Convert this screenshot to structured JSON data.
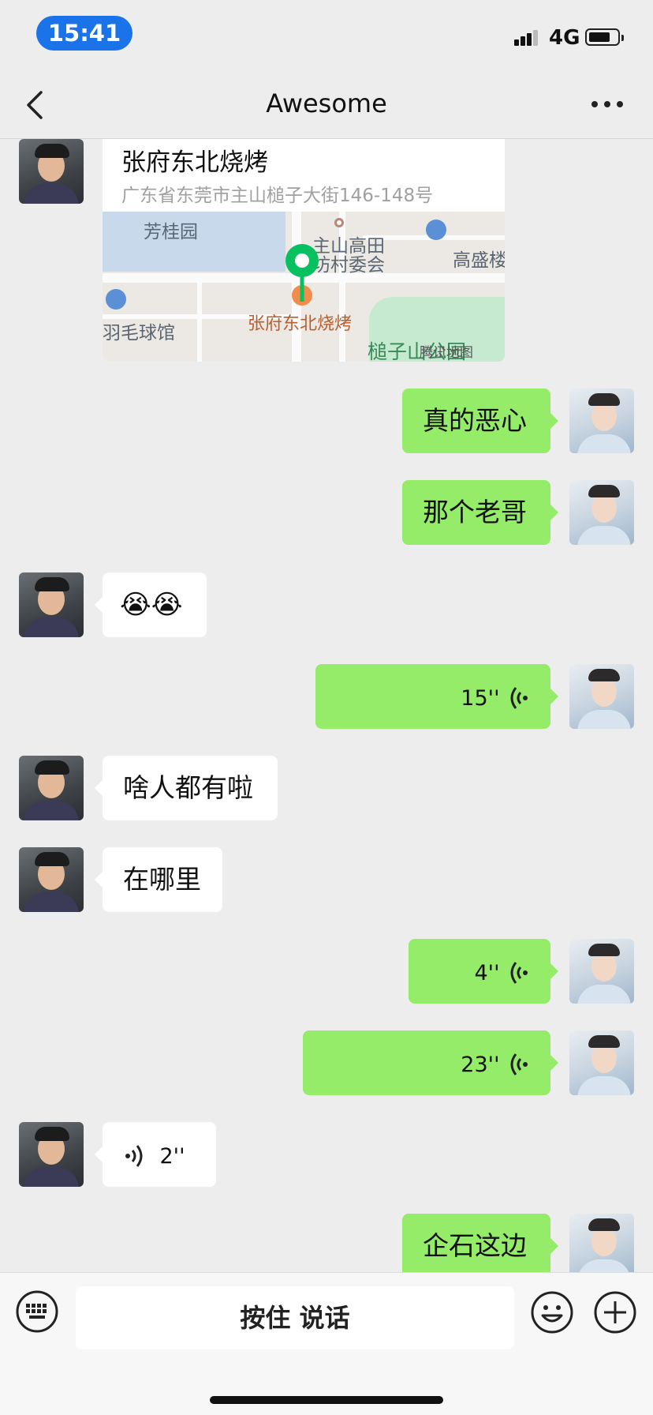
{
  "status_bar": {
    "time": "15:41",
    "network": "4G"
  },
  "nav": {
    "title": "Awesome"
  },
  "location": {
    "name": "张府东北烧烤",
    "address": "广东省东莞市主山槌子大街146-148号",
    "map_labels": {
      "area": "芳桂园",
      "committee_line1": "主山高田",
      "committee_line2": "坊村委会",
      "building": "高盛楼",
      "gym": "羽毛球馆",
      "poi": "张府东北烧烤",
      "park": "槌子山公园",
      "provider": "腾讯地图"
    }
  },
  "messages": [
    {
      "side": "right",
      "type": "text",
      "text": "真的恶心"
    },
    {
      "side": "right",
      "type": "text",
      "text": "那个老哥"
    },
    {
      "side": "left",
      "type": "emoji",
      "text": "😭😭"
    },
    {
      "side": "right",
      "type": "voice",
      "text": "15''"
    },
    {
      "side": "left",
      "type": "text",
      "text": "啥人都有啦"
    },
    {
      "side": "left",
      "type": "text",
      "text": "在哪里"
    },
    {
      "side": "right",
      "type": "voice",
      "text": "4''"
    },
    {
      "side": "right",
      "type": "voice",
      "text": "23''"
    },
    {
      "side": "left",
      "type": "voice",
      "text": "2''"
    },
    {
      "side": "right",
      "type": "text",
      "text": "企石这边"
    }
  ],
  "input_bar": {
    "talk_label": "按住 说话"
  },
  "colors": {
    "self_bubble": "#95ec69",
    "other_bubble": "#ffffff",
    "background": "#ededed",
    "time_pill": "#1a73e8"
  },
  "icons": [
    "back-icon",
    "more-icon",
    "keyboard-icon",
    "emoji-icon",
    "plus-icon",
    "voice-icon",
    "map-pin-icon"
  ]
}
